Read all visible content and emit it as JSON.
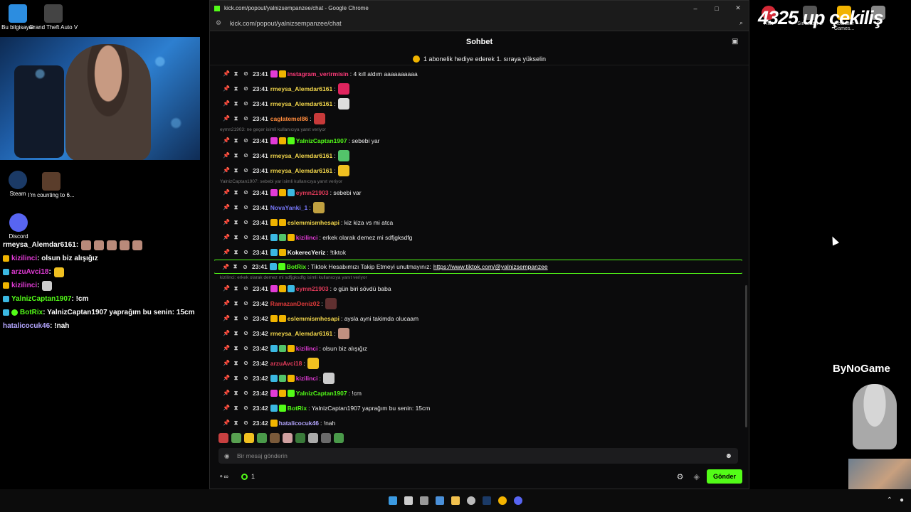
{
  "desktop": {
    "icons": [
      {
        "label": "Bu bilgisayar"
      },
      {
        "label": "Grand Theft Auto V"
      },
      {
        "label": "Steam"
      },
      {
        "label": "I'm counting to 6..."
      },
      {
        "label": "Discord"
      }
    ],
    "right_icons": [
      {
        "label": "Riot"
      },
      {
        "label": "Simulator 2"
      },
      {
        "label": "Rockstar Games..."
      },
      {
        "label": "2"
      }
    ]
  },
  "overlay_chat": [
    {
      "user": "rmeysa_Alemdar6161",
      "text": ":",
      "user_color": "#ffffff"
    },
    {
      "user": "kizilinci",
      "text": ": olsun biz alışığız",
      "user_color": "#e23bd6"
    },
    {
      "user": "arzuAvci18",
      "text": ":",
      "user_color": "#e23bd6"
    },
    {
      "user": "kizilinci",
      "text": ":",
      "user_color": "#e23bd6"
    },
    {
      "user": "YalnizCaptan1907",
      "text": ": !cm",
      "user_color": "#53fc18"
    },
    {
      "user": "BotRix",
      "text": ": YalnizCaptan1907 yaprağım bu senin: 15cm",
      "user_color": "#53fc18"
    },
    {
      "user": "hatalicocuk46",
      "text": ": !nah",
      "user_color": "#b4a6ff"
    }
  ],
  "browser": {
    "window_title": "kick.com/popout/yalnizsempanzee/chat - Google Chrome",
    "url": "kick.com/popout/yalnizsempanzee/chat",
    "minimize": "–",
    "maximize": "□",
    "close": "✕"
  },
  "chat": {
    "header": "Sohbet",
    "pinned": "1 abonelik hediye ederek 1. sıraya yükselin",
    "messages": [
      {
        "time": "23:41",
        "user": "instagram_verirmisin",
        "text": ": 4 kıll aldım aaaaaaaaaa",
        "color": "#ff3b7a",
        "badges": [
          "#e23bd6",
          "#f0b400"
        ]
      },
      {
        "time": "23:41",
        "user": "rmeysa_Alemdar6161",
        "text": ":",
        "color": "#f2d64b",
        "emote": "#e0245e"
      },
      {
        "time": "23:41",
        "user": "rmeysa_Alemdar6161",
        "text": ":",
        "color": "#f2d64b",
        "emote": "#dddddd"
      },
      {
        "time": "23:41",
        "user": "caglatemel86",
        "text": ":",
        "color": "#ff8b3d",
        "emote": "#c83a3a"
      },
      {
        "reply": "eymn21903: ne geçer isimli kullanıcıya yanıt veriyor"
      },
      {
        "time": "23:41",
        "user": "YalnizCaptan1907",
        "text": ": sebebi yar",
        "color": "#53fc18",
        "badges": [
          "#e23bd6",
          "#f0b400",
          "#53fc18"
        ]
      },
      {
        "time": "23:41",
        "user": "rmeysa_Alemdar6161",
        "text": ":",
        "color": "#f2d64b",
        "emote": "#53c46a"
      },
      {
        "time": "23:41",
        "user": "rmeysa_Alemdar6161",
        "text": ":",
        "color": "#f2d64b",
        "emote": "#f0c020"
      },
      {
        "reply": "YalnizCaptan1907: sebebi yar isimli kullanıcıya yanıt veriyor"
      },
      {
        "time": "23:41",
        "user": "eymn21903",
        "text": ": sebebi var",
        "color": "#e23b5a",
        "badges": [
          "#e23bd6",
          "#f0b400",
          "#3bb8e2"
        ]
      },
      {
        "time": "23:41",
        "user": "NovaYanki_1",
        "text": ":",
        "color": "#7a7aff",
        "emote": "#c0a040"
      },
      {
        "time": "23:41",
        "user": "eslemmismhesapi",
        "text": ": kiz kiza vs mi atca",
        "color": "#f2d64b",
        "badges": [
          "#f0b400",
          "#f0b400"
        ]
      },
      {
        "time": "23:41",
        "user": "kizilinci",
        "text": ": erkek olarak demez mi sdfjgksdfg",
        "color": "#e23bd6",
        "badges": [
          "#3bb8e2",
          "#53c46a",
          "#f0b400"
        ]
      },
      {
        "time": "23:41",
        "user": "KokerecYeriz",
        "text": ": !tiktok",
        "color": "#ffffff",
        "badges": [
          "#3bb8e2",
          "#f0b400"
        ]
      },
      {
        "time": "23:41",
        "user": "BotRix",
        "text": ": Tiktok Hesabımızı Takip Etmeyi unutmayınız:",
        "link": "https://www.tiktok.com/@yalnizsempanzee",
        "color": "#53fc18",
        "badges": [
          "#3bb8e2",
          "#53fc18"
        ],
        "highlight": true
      },
      {
        "reply": "kizilinci: erkek olarak demez mi sdfjgksdfg isimli kullanıcıya yanıt veriyor"
      },
      {
        "time": "23:41",
        "user": "eymn21903",
        "text": ": o gün biri sövdü baba",
        "color": "#e23b5a",
        "badges": [
          "#e23bd6",
          "#f0b400",
          "#3bb8e2"
        ]
      },
      {
        "time": "23:42",
        "user": "RamazanDeniz02",
        "text": ":",
        "color": "#e23b3b",
        "emote": "#603030"
      },
      {
        "time": "23:42",
        "user": "eslemmismhesapi",
        "text": ": aysla ayni takimda olucaam",
        "color": "#f2d64b",
        "badges": [
          "#f0b400",
          "#f0b400"
        ]
      },
      {
        "time": "23:42",
        "user": "rmeysa_Alemdar6161",
        "text": ":",
        "color": "#f2d64b",
        "emote": "#c09080"
      },
      {
        "time": "23:42",
        "user": "kizilinci",
        "text": ": olsun biz alışığız",
        "color": "#e23bd6",
        "badges": [
          "#3bb8e2",
          "#53c46a",
          "#f0b400"
        ]
      },
      {
        "time": "23:42",
        "user": "arzuAvci18",
        "text": ":",
        "color": "#e23b5a",
        "emote": "#f0c020"
      },
      {
        "time": "23:42",
        "user": "kizilinci",
        "text": ":",
        "color": "#e23bd6",
        "badges": [
          "#3bb8e2",
          "#53c46a",
          "#f0b400"
        ],
        "emote": "#cccccc"
      },
      {
        "time": "23:42",
        "user": "YalnizCaptan1907",
        "text": ": !cm",
        "color": "#53fc18",
        "badges": [
          "#e23bd6",
          "#f0b400",
          "#53fc18"
        ]
      },
      {
        "time": "23:42",
        "user": "BotRix",
        "text": ": YalnizCaptan1907 yaprağım bu senin: 15cm",
        "color": "#53fc18",
        "badges": [
          "#3bb8e2",
          "#53fc18"
        ]
      },
      {
        "time": "23:42",
        "user": "hatalicocuk46",
        "text": ": !nah",
        "color": "#b4a6ff",
        "badges": [
          "#f0b400"
        ]
      }
    ],
    "input_placeholder": "Bir mesaj gönderin",
    "points": "1",
    "send_label": "Gönder"
  },
  "stream_overlay": {
    "title": "4325 up çekiliş",
    "sponsor": "ByNoGame"
  },
  "colors": {
    "accent": "#53fc18",
    "chat_bg": "#0b0b0c"
  }
}
